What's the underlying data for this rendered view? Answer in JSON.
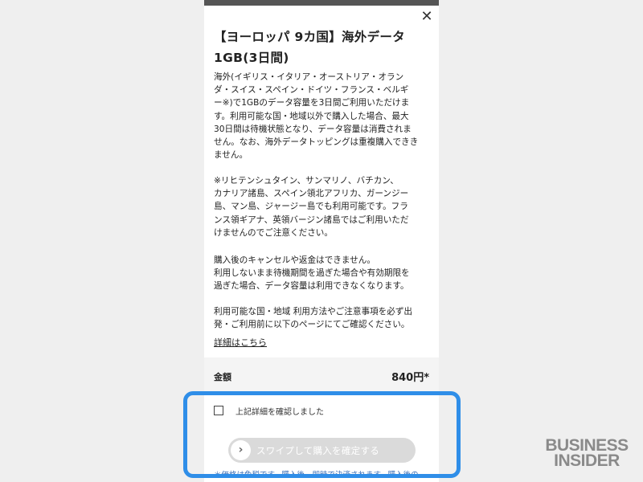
{
  "modal": {
    "close_icon": "close-icon",
    "title": "【ヨーロッパ 9カ国】海外データ\n1GB(3日間)",
    "description": "海外(イギリス・イタリア・オーストリア・オラン\nダ・スイス・スペイン・ドイツ・フランス・ベルギ\nー※)で1GBのデータ容量を3日間ご利用いただけま\nす。利用可能な国・地域以外で購入した場合、最大\n30日間は待機状態となり、データ容量は消費されま\nせん。なお、海外データトッピングは重複購入できき\nません。",
    "note": "※リヒテンシュタイン、サンマリノ、バチカン、\nカナリア諸島、スペイン領北アフリカ、ガーンジー\n島、マン島、ジャージー島でも利用可能です。フラ\nンス領ギアナ、英領バージン諸島ではご利用いただ\nけませんのでご注意ください。",
    "cancel_policy": "購入後のキャンセルや返金はできません。\n利用しないまま待機期間を過ぎた場合や有効期限を\n過ぎた場合、データ容量は利用できなくなります。",
    "notice": "利用可能な国・地域 利用方法やご注意事項を必ず出\n発・ご利用前に以下のページにてご確認ください。",
    "detail_link": "詳細はこちら",
    "price_label": "金額",
    "price_value": "840円*",
    "confirm_label": "上記詳細を確認しました",
    "confirm_checked": false,
    "swipe_label": "スワイプして購入を確定する",
    "swipe_icon": "chevron-right-icon",
    "footnote": "＊価格は免税です。購入後、即時で決済されます。購入後の"
  },
  "watermark": {
    "line1": "BUSINESS",
    "line2": "INSIDER"
  },
  "colors": {
    "highlight": "#2f8ee8",
    "swipe_bg": "#dadada",
    "footnote": "#3a6fb8",
    "topbar": "#555555"
  }
}
